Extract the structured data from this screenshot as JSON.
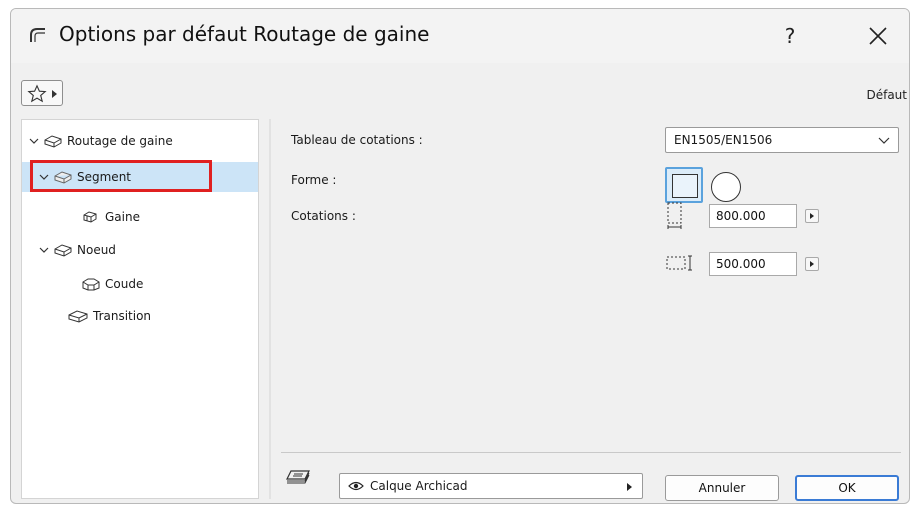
{
  "window": {
    "title": "Options par défaut Routage de gaine",
    "help_label": "?"
  },
  "toolbar": {
    "favorites_icon": "star-icon",
    "default_label": "Défaut"
  },
  "tree": {
    "items": [
      {
        "label": "Routage de gaine",
        "expanded": true,
        "icon": "duct-icon"
      },
      {
        "label": "Segment",
        "expanded": true,
        "selected": true,
        "icon": "duct-icon"
      },
      {
        "label": "Gaine",
        "icon": "duct-piece-icon"
      },
      {
        "label": "Noeud",
        "expanded": true,
        "icon": "duct-icon"
      },
      {
        "label": "Coude",
        "icon": "elbow-icon"
      },
      {
        "label": "Transition",
        "icon": "transition-icon"
      }
    ]
  },
  "settings": {
    "table_label": "Tableau de cotations :",
    "table_value": "EN1505/EN1506",
    "shape_label": "Forme :",
    "shape_options": [
      "rectangle",
      "circle"
    ],
    "shape_selected": "rectangle",
    "dims_label": "Cotations :",
    "width_value": "800.000",
    "height_value": "500.000"
  },
  "footer": {
    "layer_value": "Calque Archicad",
    "cancel_label": "Annuler",
    "ok_label": "OK"
  },
  "colors": {
    "selection": "#cce4f7",
    "highlight": "#e02020",
    "accent": "#3a7bd5"
  }
}
